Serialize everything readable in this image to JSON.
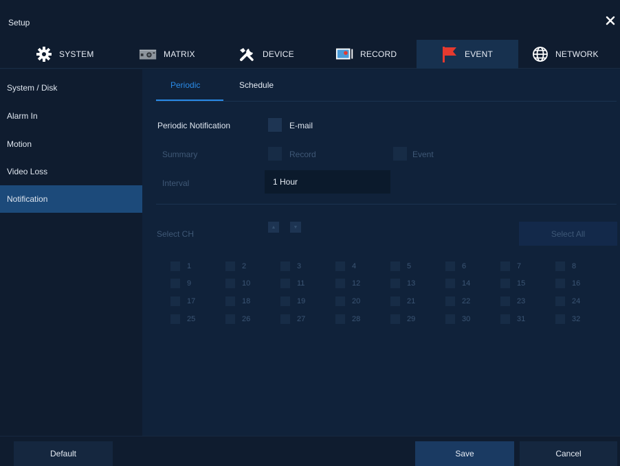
{
  "window": {
    "title": "Setup"
  },
  "tabs": [
    {
      "label": "SYSTEM",
      "icon": "gear-icon"
    },
    {
      "label": "MATRIX",
      "icon": "matrix-icon"
    },
    {
      "label": "DEVICE",
      "icon": "tools-icon"
    },
    {
      "label": "RECORD",
      "icon": "record-icon"
    },
    {
      "label": "EVENT",
      "icon": "flag-icon",
      "active": true
    },
    {
      "label": "NETWORK",
      "icon": "globe-icon"
    }
  ],
  "sidebar": {
    "items": [
      {
        "label": "System / Disk"
      },
      {
        "label": "Alarm In"
      },
      {
        "label": "Motion"
      },
      {
        "label": "Video Loss"
      },
      {
        "label": "Notification",
        "active": true
      }
    ]
  },
  "subtabs": [
    {
      "label": "Periodic",
      "active": true
    },
    {
      "label": "Schedule"
    }
  ],
  "form": {
    "periodic_notification_label": "Periodic Notification",
    "email_label": "E-mail",
    "summary_label": "Summary",
    "record_label": "Record",
    "event_label": "Event",
    "interval_label": "Interval",
    "interval_value": "1 Hour",
    "select_ch_label": "Select CH",
    "select_all_label": "Select All"
  },
  "channels": [
    "1",
    "2",
    "3",
    "4",
    "5",
    "6",
    "7",
    "8",
    "9",
    "10",
    "11",
    "12",
    "13",
    "14",
    "15",
    "16",
    "17",
    "18",
    "19",
    "20",
    "21",
    "22",
    "23",
    "24",
    "25",
    "26",
    "27",
    "28",
    "29",
    "30",
    "31",
    "32"
  ],
  "footer": {
    "default_label": "Default",
    "save_label": "Save",
    "cancel_label": "Cancel"
  },
  "colors": {
    "accent": "#2a8be8",
    "active_sidebar": "#1c4a7a",
    "event_flag": "#e53a2f"
  }
}
